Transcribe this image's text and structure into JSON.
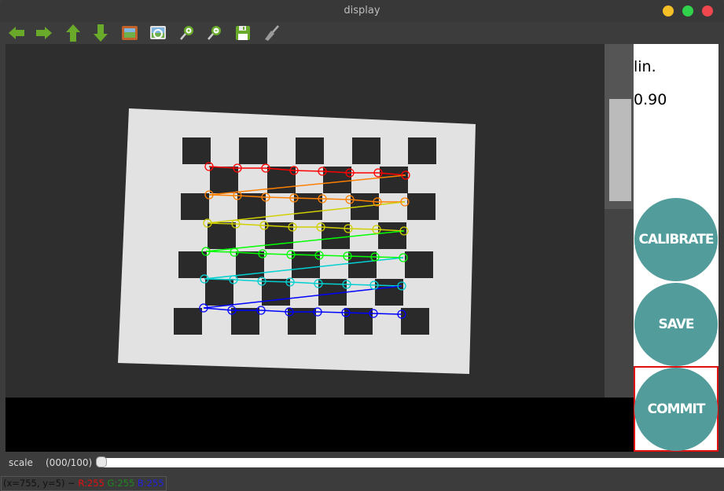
{
  "window": {
    "title": "display",
    "controls": [
      {
        "name": "minimize",
        "color": "#f5bf27"
      },
      {
        "name": "maximize",
        "color": "#2fd24a"
      },
      {
        "name": "close",
        "color": "#f0464e"
      }
    ]
  },
  "toolbar": {
    "items": [
      {
        "name": "pan-left",
        "icon": "arrow-left-icon"
      },
      {
        "name": "pan-right",
        "icon": "arrow-right-icon"
      },
      {
        "name": "pan-up",
        "icon": "arrow-up-icon"
      },
      {
        "name": "pan-down",
        "icon": "arrow-down-icon"
      },
      {
        "name": "zoom-original",
        "icon": "image-icon"
      },
      {
        "name": "zoom-fit",
        "icon": "image-zoom-icon"
      },
      {
        "name": "zoom-in",
        "icon": "zoom-in-icon"
      },
      {
        "name": "zoom-out",
        "icon": "zoom-out-icon"
      },
      {
        "name": "save-image",
        "icon": "floppy-disk-icon"
      },
      {
        "name": "properties",
        "icon": "brush-icon"
      }
    ]
  },
  "panel": {
    "label": "lin.",
    "value": "0.90",
    "buttons": {
      "calibrate": "CALIBRATE",
      "save": "SAVE",
      "commit": "COMMIT"
    },
    "button_color": "#529d9b",
    "highlight_color": "#e01010"
  },
  "trackbar": {
    "label": "scale",
    "value_text": "(000/100)",
    "value": 0,
    "max": 100
  },
  "statusbar": {
    "coords": "(x=755, y=5) ~",
    "r": "R:255",
    "g": "G:255",
    "b": "B:255",
    "r_color": "#e01010",
    "g_color": "#1e8a1e",
    "b_color": "#2020e0"
  },
  "chessboard": {
    "row_colors": [
      "#ff0000",
      "#ff8000",
      "#d0d000",
      "#00ff00",
      "#00d0d0",
      "#0000ff"
    ]
  }
}
